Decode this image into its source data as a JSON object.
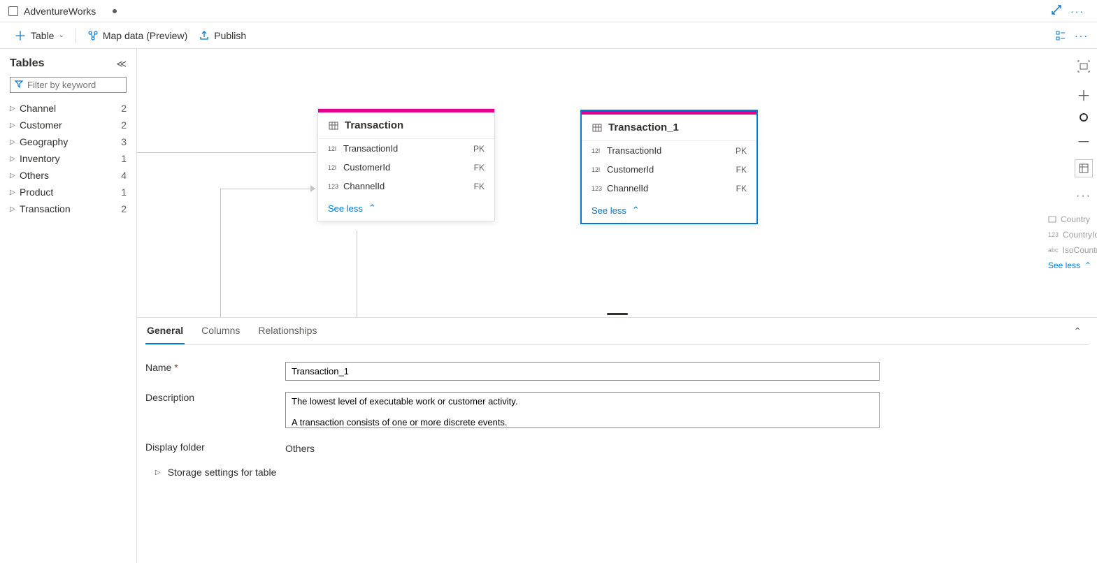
{
  "titlebar": {
    "title": "AdventureWorks",
    "dirty": true
  },
  "toolbar": {
    "table_label": "Table",
    "map_label": "Map data (Preview)",
    "publish_label": "Publish"
  },
  "sidebar": {
    "title": "Tables",
    "filter_placeholder": "Filter by keyword",
    "items": [
      {
        "label": "Channel",
        "count": "2"
      },
      {
        "label": "Customer",
        "count": "2"
      },
      {
        "label": "Geography",
        "count": "3"
      },
      {
        "label": "Inventory",
        "count": "1"
      },
      {
        "label": "Others",
        "count": "4"
      },
      {
        "label": "Product",
        "count": "1"
      },
      {
        "label": "Transaction",
        "count": "2"
      }
    ]
  },
  "canvas": {
    "tables": [
      {
        "name": "Transaction",
        "selected": false,
        "columns": [
          {
            "type": "12l",
            "name": "TransactionId",
            "key": "PK"
          },
          {
            "type": "12l",
            "name": "CustomerId",
            "key": "FK"
          },
          {
            "type": "123",
            "name": "ChannelId",
            "key": "FK"
          }
        ],
        "see_less": "See less"
      },
      {
        "name": "Transaction_1",
        "selected": true,
        "columns": [
          {
            "type": "12l",
            "name": "TransactionId",
            "key": "PK"
          },
          {
            "type": "12l",
            "name": "CustomerId",
            "key": "FK"
          },
          {
            "type": "123",
            "name": "ChannelId",
            "key": "FK"
          }
        ],
        "see_less": "See less"
      }
    ],
    "ghost": {
      "title": "Country",
      "rows": [
        {
          "type": "123",
          "label": "CountryId"
        },
        {
          "type": "abc",
          "label": "IsoCountr"
        }
      ],
      "see_less": "See less"
    }
  },
  "panel": {
    "tabs": [
      "General",
      "Columns",
      "Relationships"
    ],
    "active_tab": 0,
    "name_label": "Name",
    "name_value": "Transaction_1",
    "desc_label": "Description",
    "desc_value": "The lowest level of executable work or customer activity.\n\nA transaction consists of one or more discrete events.",
    "folder_label": "Display folder",
    "folder_value": "Others",
    "storage_label": "Storage settings for table"
  }
}
